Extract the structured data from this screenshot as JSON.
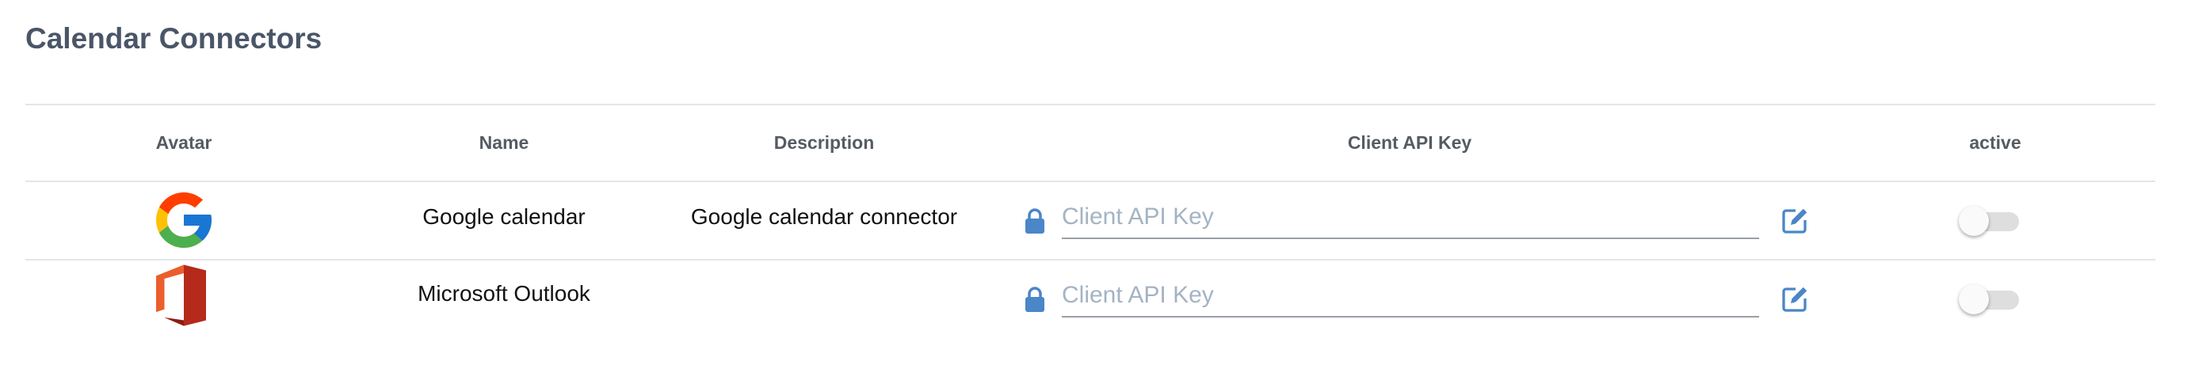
{
  "page": {
    "title": "Calendar Connectors"
  },
  "table": {
    "columns": {
      "avatar": "Avatar",
      "name": "Name",
      "description": "Description",
      "api_key": "Client API Key",
      "active": "active"
    },
    "rows": [
      {
        "avatar_icon": "google-logo-icon",
        "name": "Google calendar",
        "description": "Google calendar connector",
        "api_key_value": "",
        "api_key_placeholder": "Client API Key",
        "active": false
      },
      {
        "avatar_icon": "microsoft-office-logo-icon",
        "name": "Microsoft Outlook",
        "description": "",
        "api_key_value": "",
        "api_key_placeholder": "Client API Key",
        "active": false
      }
    ]
  },
  "colors": {
    "title": "#4a5568",
    "header_text": "#555b63",
    "accent_icon": "#4a86c8",
    "divider": "#e2e5ea",
    "toggle_track_off": "#dedede"
  }
}
